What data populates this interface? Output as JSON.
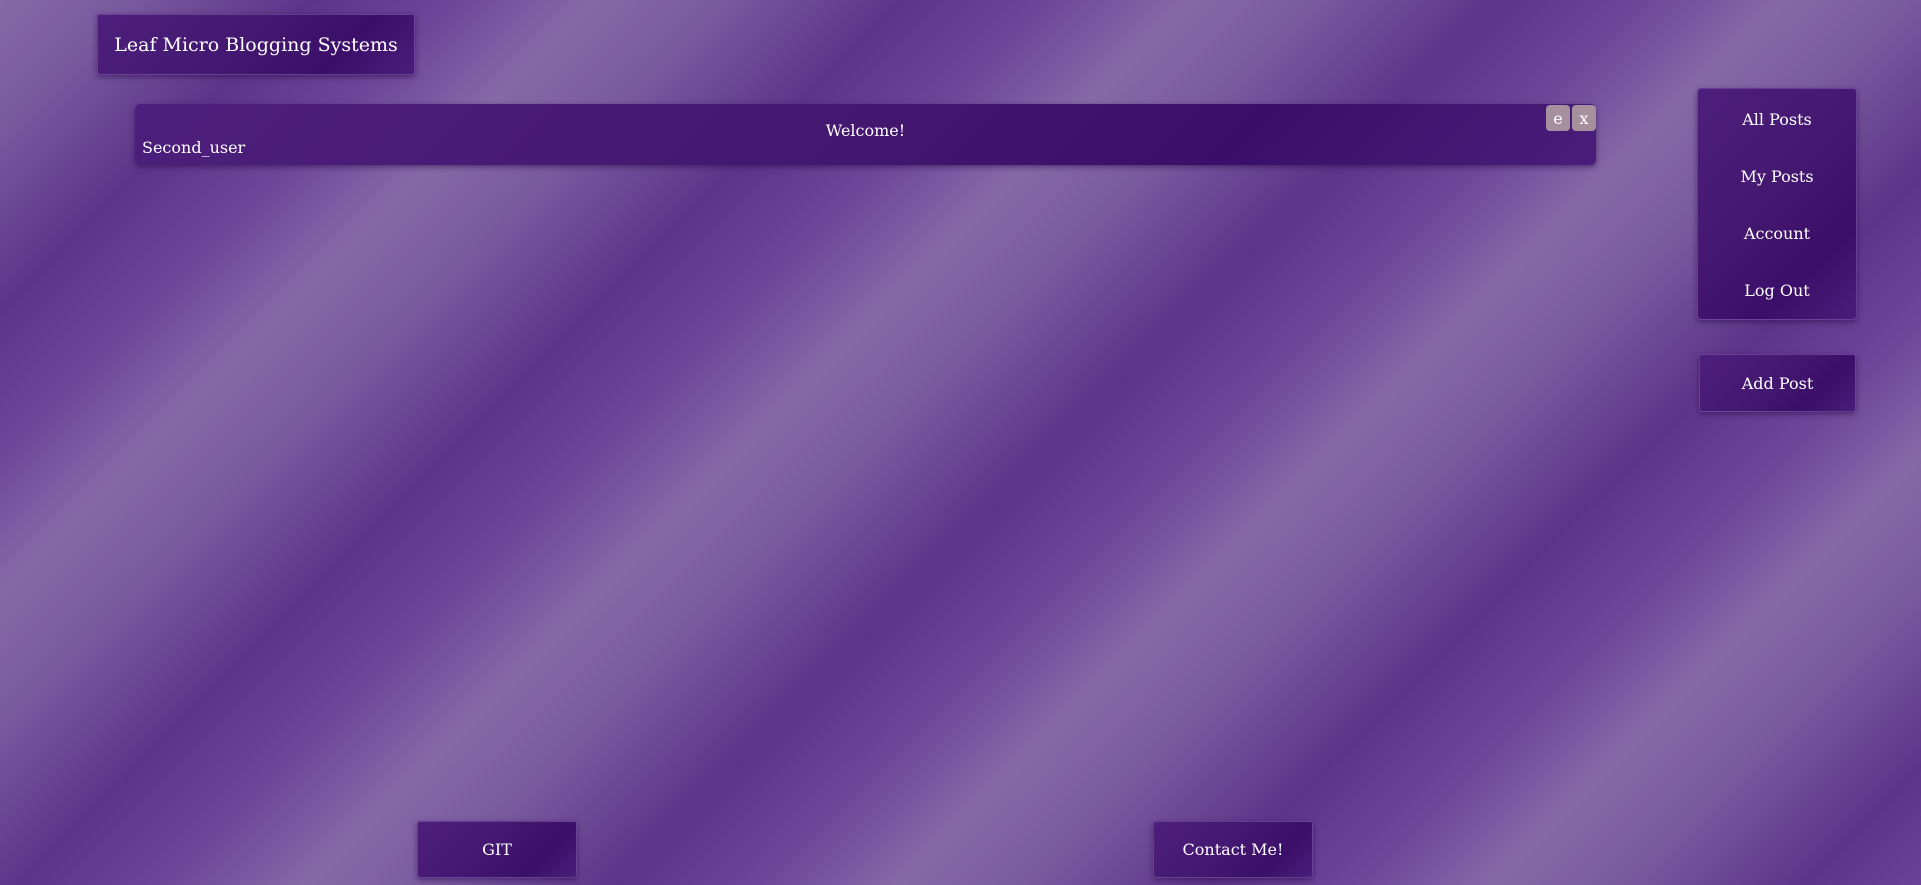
{
  "brand": {
    "title": "Leaf Micro Blogging Systems"
  },
  "post": {
    "title": "Welcome!",
    "author": "Second_user",
    "edit_label": "e",
    "delete_label": "x"
  },
  "nav": {
    "items": [
      {
        "label": "All Posts"
      },
      {
        "label": "My Posts"
      },
      {
        "label": "Account"
      },
      {
        "label": "Log Out"
      }
    ]
  },
  "actions": {
    "add_post_label": "Add Post"
  },
  "footer": {
    "git_label": "GIT",
    "contact_label": "Contact Me!"
  },
  "colors": {
    "panel": "#43176f",
    "background_light": "#8668a8",
    "background_dark": "#5e3489",
    "card_button": "#a6909e",
    "text": "#ffffff"
  }
}
